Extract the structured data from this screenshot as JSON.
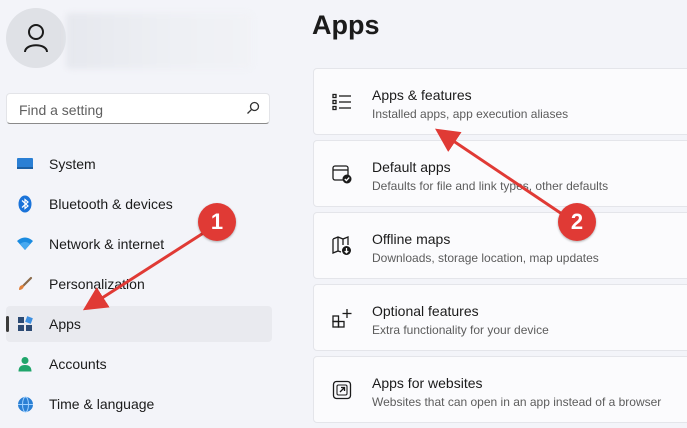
{
  "search": {
    "placeholder": "Find a setting"
  },
  "sidebar": {
    "items": [
      {
        "label": "System",
        "icon": "monitor-icon"
      },
      {
        "label": "Bluetooth & devices",
        "icon": "bluetooth-icon"
      },
      {
        "label": "Network & internet",
        "icon": "wifi-icon"
      },
      {
        "label": "Personalization",
        "icon": "brush-icon"
      },
      {
        "label": "Apps",
        "icon": "apps-icon",
        "selected": true
      },
      {
        "label": "Accounts",
        "icon": "person-icon"
      },
      {
        "label": "Time & language",
        "icon": "globe-clock-icon"
      }
    ]
  },
  "main": {
    "title": "Apps",
    "cards": [
      {
        "title": "Apps & features",
        "subtitle": "Installed apps, app execution aliases",
        "icon": "list-icon"
      },
      {
        "title": "Default apps",
        "subtitle": "Defaults for file and link types, other defaults",
        "icon": "default-apps-icon"
      },
      {
        "title": "Offline maps",
        "subtitle": "Downloads, storage location, map updates",
        "icon": "map-download-icon"
      },
      {
        "title": "Optional features",
        "subtitle": "Extra functionality for your device",
        "icon": "grid-plus-icon"
      },
      {
        "title": "Apps for websites",
        "subtitle": "Websites that can open in an app instead of a browser",
        "icon": "open-external-icon"
      }
    ]
  },
  "annotations": {
    "badge1": "1",
    "badge2": "2"
  },
  "colors": {
    "annotation": "#e03a35",
    "accent": "#0067c0"
  }
}
